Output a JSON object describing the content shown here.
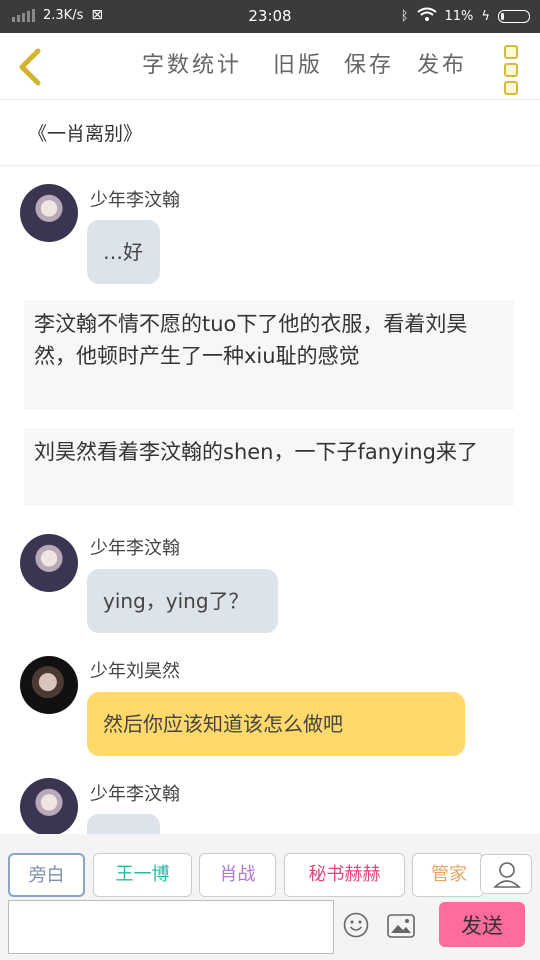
{
  "status_bar": {
    "net_speed": "2.3K/s",
    "time": "23:08",
    "battery": "11%"
  },
  "toolbar": {
    "word_count": "字数统计",
    "old_version": "旧版",
    "save": "保存",
    "publish": "发布"
  },
  "story": {
    "title": "《一肖离别》"
  },
  "messages": [
    {
      "speaker": "少年李汶翰",
      "text": "…好"
    },
    {
      "narration": "李汶翰不情不愿的tuo下了他的衣服，看着刘昊然，他顿时产生了一种xiu耻的感觉"
    },
    {
      "narration": "刘昊然看着李汶翰的shen，一下子fanying来了"
    },
    {
      "speaker": "少年李汶翰",
      "text": "ying，ying了？"
    },
    {
      "speaker": "少年刘昊然",
      "text": "然后你应该知道该怎么做吧"
    },
    {
      "speaker": "少年李汶翰",
      "text": ""
    }
  ],
  "roles": [
    {
      "label": "旁白",
      "color": "#7e8fb0"
    },
    {
      "label": "王一博",
      "color": "#2bb8a6"
    },
    {
      "label": "肖战",
      "color": "#b07ad6"
    },
    {
      "label": "秘书赫赫",
      "color": "#e0457f"
    },
    {
      "label": "管家",
      "color": "#e8a56a"
    }
  ],
  "composer": {
    "value": "",
    "placeholder": "",
    "send": "发送"
  }
}
